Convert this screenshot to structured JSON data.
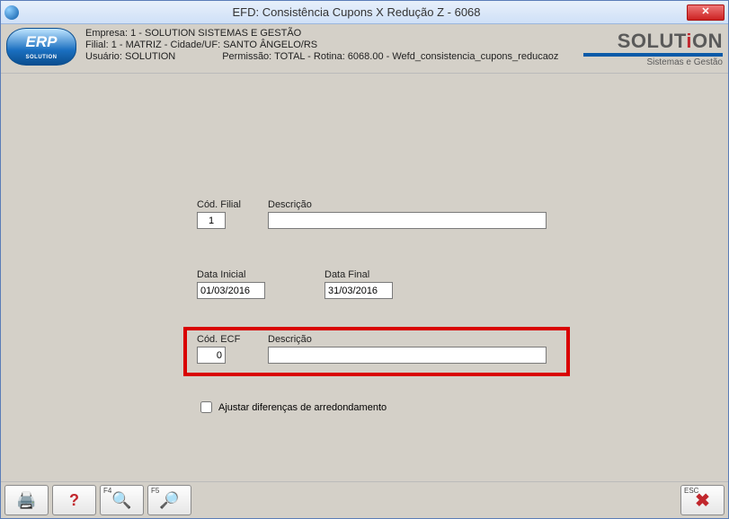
{
  "window": {
    "title": "EFD: Consistência Cupons X Redução Z - 6068"
  },
  "header": {
    "empresa": "Empresa: 1 - SOLUTION SISTEMAS E GESTÃO",
    "filial": "Filial: 1 - MATRIZ - Cidade/UF: SANTO ÂNGELO/RS",
    "usuario": "Usuário: SOLUTION",
    "permissao": "Permissão: TOTAL - Rotina: 6068.00 - Wefd_consistencia_cupons_reducaoz",
    "erp_logo_text": "ERP",
    "erp_logo_sub": "SOLUTION",
    "solution_logo_main": "SOLUT",
    "solution_logo_i": "i",
    "solution_logo_on": "ON",
    "solution_logo_sub": "Sistemas e Gestão"
  },
  "form": {
    "cod_filial_label": "Cód. Filial",
    "cod_filial_value": "1",
    "descricao_filial_label": "Descrição",
    "descricao_filial_value": "",
    "data_inicial_label": "Data Inicial",
    "data_inicial_value": "01/03/2016",
    "data_final_label": "Data Final",
    "data_final_value": "31/03/2016",
    "cod_ecf_label": "Cód. ECF",
    "cod_ecf_value": "0",
    "descricao_ecf_label": "Descrição",
    "descricao_ecf_value": "",
    "ajustar_label": "Ajustar diferenças de arredondamento"
  },
  "toolbar": {
    "f4_key": "F4",
    "f5_key": "F5",
    "esc_key": "ESC"
  }
}
